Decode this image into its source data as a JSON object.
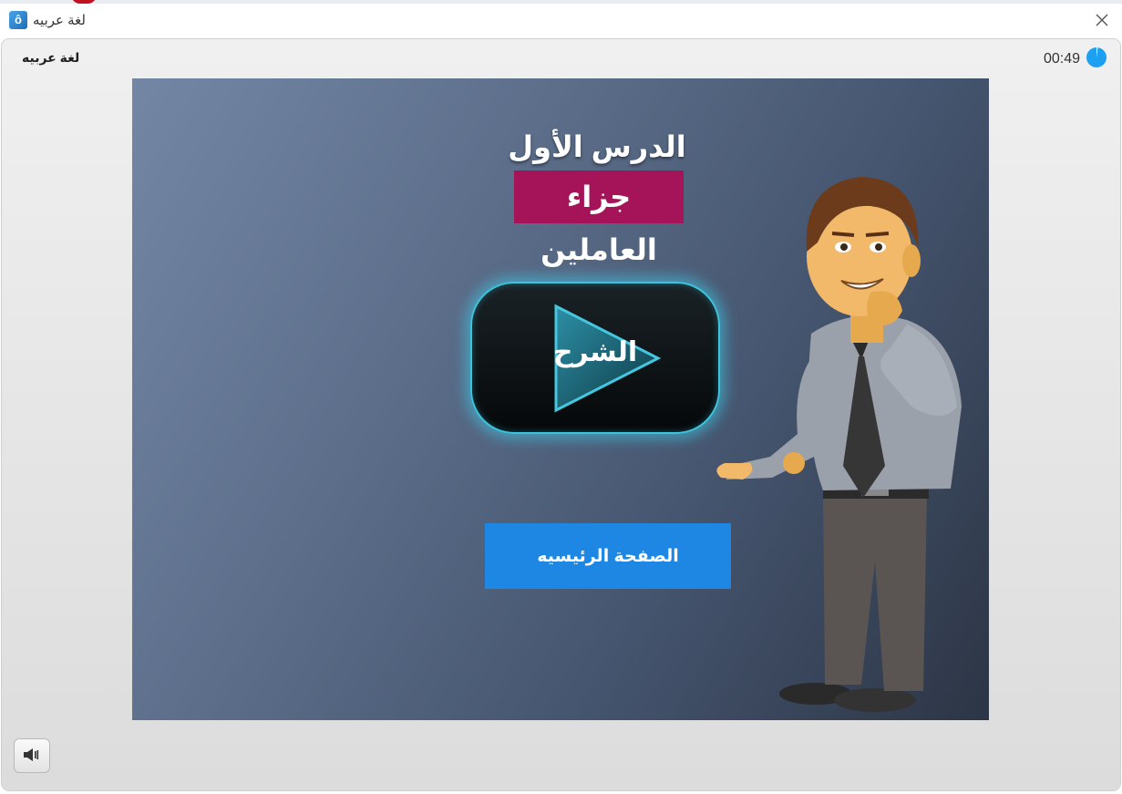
{
  "window": {
    "title": "لغة عربيه",
    "app_icon_glyph": "ô",
    "close_icon": "close-icon"
  },
  "player": {
    "course_label": "لغة عربيه",
    "timer": "00:49",
    "timer_icon": "pie-timer-icon",
    "colors": {
      "accent": "#1ea0f0",
      "frame": "#e6e6e6"
    }
  },
  "slide": {
    "title": "الدرس الأول",
    "subtitle": "جزاء العاملين",
    "play_button_label": "الشرح",
    "home_button_label": "الصفحة الرئيسيه",
    "colors": {
      "subtitle_bg": "#a51459",
      "home_button_bg": "#1d87e3",
      "play_glow": "#3cc4dc"
    }
  },
  "controls": {
    "mute_icon": "speaker-icon"
  }
}
